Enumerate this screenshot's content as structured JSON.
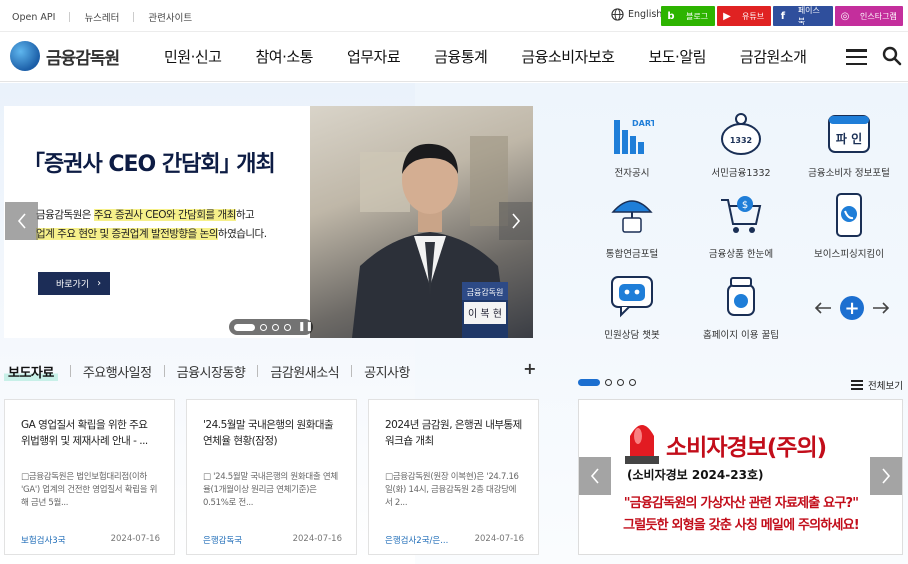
{
  "topbar": {
    "links": [
      "Open API",
      "뉴스레터",
      "관련사이트"
    ],
    "language": "English",
    "sns": [
      {
        "label": "블로그",
        "icon": "b",
        "color": "#2db400"
      },
      {
        "label": "유튜브",
        "icon": "▶",
        "color": "#e02222"
      },
      {
        "label": "페이스북",
        "icon": "f",
        "color": "#2f4f9c"
      },
      {
        "label": "인스타그램",
        "icon": "◎",
        "color": "#c42e9c"
      }
    ]
  },
  "header": {
    "logo": "금융감독원",
    "nav": [
      "민원·신고",
      "참여·소통",
      "업무자료",
      "금융통계",
      "금융소비자보호",
      "보도·알림",
      "금감원소개"
    ]
  },
  "banner": {
    "headline": "｢증권사 CEO 간담회｣ 개최",
    "desc_line1_pre": "금융감독원은 ",
    "desc_line1_hl": "주요 증권사 CEO와 간담회를 개최",
    "desc_line1_post": "하고",
    "desc_line2_hl1": "업계 주요 현안 및 증권업계 발전방향을 논의",
    "desc_line2_post": "하였습니다.",
    "go_label": "바로가기",
    "nameplate_org": "금융감독원",
    "nameplate_name": "이 복 현"
  },
  "quick_links": [
    {
      "label": "전자공시",
      "icon": "dart-icon"
    },
    {
      "label": "서민금융1332",
      "icon": "piggy-bank-icon"
    },
    {
      "label": "금융소비자 정보포털",
      "icon": "fine-portal-icon"
    },
    {
      "label": "통합연금포털",
      "icon": "umbrella-icon"
    },
    {
      "label": "금융상품 한눈에",
      "icon": "shopping-cart-icon"
    },
    {
      "label": "보이스피싱지킴이",
      "icon": "phone-icon"
    },
    {
      "label": "민원상담 챗봇",
      "icon": "chatbot-icon"
    },
    {
      "label": "홈페이지 이용 꿀팁",
      "icon": "honey-jar-icon"
    }
  ],
  "news_tabs": {
    "active": "보도자료",
    "others": [
      "주요행사일정",
      "금융시장동향",
      "금감원새소식",
      "공지사항"
    ],
    "more": "+"
  },
  "cards": [
    {
      "title": "GA 영업질서 확립을 위한 주요 위법행위 및 제재사례 안내 - ...",
      "summary": "□금융감독원은 법인보험대리점(이하 'GA') 업계의 건전한 영업질서 확립을 위해 금년 5월...",
      "category": "보험검사3국",
      "date": "2024-07-16"
    },
    {
      "title": "'24.5월말 국내은행의 원화대출 연체율 현황(잠정)",
      "summary": "□ '24.5월말 국내은행의 원화대출 연체율(1개월이상 원리금 연체기준)은 0.51%로 전...",
      "category": "은행감독국",
      "date": "2024-07-16"
    },
    {
      "title": "2024년 금감원, 은행권 내부통제 워크숍 개최",
      "summary": "□금융감독원(원장 이복현)은 '24.7.16일(화) 14시, 금융감독원 2층 대강당에서 2...",
      "category": "은행검사2국/은...",
      "date": "2024-07-16"
    }
  ],
  "side": {
    "view_all": "전체보기",
    "alert_title": "소비자경보(주의)",
    "alert_sub": "(소비자경보 2024-23호)",
    "alert_line1": "\"금융감독원의 가상자산 관련 자료제출 요구?\"",
    "alert_line2": "그럴듯한 외형을 갖춘 사칭 메일에 주의하세요!"
  }
}
